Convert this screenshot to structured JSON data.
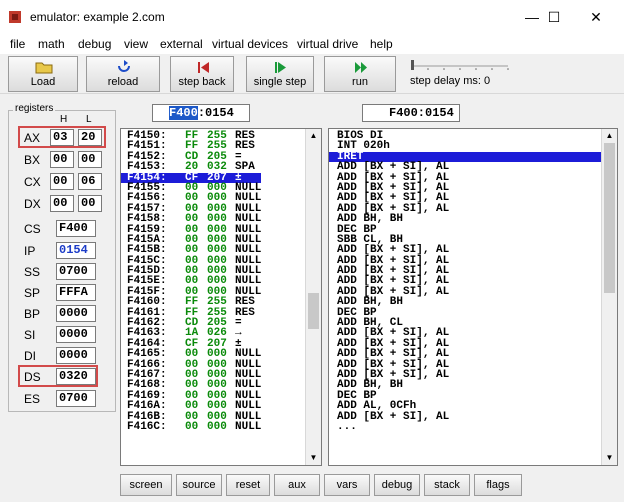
{
  "window": {
    "title": "emulator: example 2.com",
    "minimize": "—",
    "maximize": "☐",
    "close": "✕"
  },
  "menu": [
    "file",
    "math",
    "debug",
    "view",
    "external",
    "virtual devices",
    "virtual drive",
    "help"
  ],
  "toolbar": {
    "load": "Load",
    "reload": "reload",
    "step_back": "step back",
    "single_step": "single step",
    "run": "run",
    "step_delay": "step delay ms: 0"
  },
  "address_left": {
    "selected": "F400",
    "rest": ":0154"
  },
  "address_right": "F400:0154",
  "registers": {
    "legend": "registers",
    "h_label": "H",
    "l_label": "L",
    "AX": {
      "name": "AX",
      "h": "03",
      "l": "20"
    },
    "BX": {
      "name": "BX",
      "h": "00",
      "l": "00"
    },
    "CX": {
      "name": "CX",
      "h": "00",
      "l": "06"
    },
    "DX": {
      "name": "DX",
      "h": "00",
      "l": "00"
    },
    "CS": {
      "name": "CS",
      "value": "F400"
    },
    "IP": {
      "name": "IP",
      "value": "0154"
    },
    "SS": {
      "name": "SS",
      "value": "0700"
    },
    "SP": {
      "name": "SP",
      "value": "FFFA"
    },
    "BP": {
      "name": "BP",
      "value": "0000"
    },
    "SI": {
      "name": "SI",
      "value": "0000"
    },
    "DI": {
      "name": "DI",
      "value": "0000"
    },
    "DS": {
      "name": "DS",
      "value": "0320"
    },
    "ES": {
      "name": "ES",
      "value": "0700"
    }
  },
  "memory": [
    {
      "addr": "F4150:",
      "hex": "FF",
      "dec": "255",
      "chr": "RES"
    },
    {
      "addr": "F4151:",
      "hex": "FF",
      "dec": "255",
      "chr": "RES"
    },
    {
      "addr": "F4152:",
      "hex": "CD",
      "dec": "205",
      "chr": "="
    },
    {
      "addr": "F4153:",
      "hex": "20",
      "dec": "032",
      "chr": "SPA"
    },
    {
      "addr": "F4154:",
      "hex": "CF",
      "dec": "207",
      "chr": "±",
      "selected": true
    },
    {
      "addr": "F4155:",
      "hex": "00",
      "dec": "000",
      "chr": "NULL"
    },
    {
      "addr": "F4156:",
      "hex": "00",
      "dec": "000",
      "chr": "NULL"
    },
    {
      "addr": "F4157:",
      "hex": "00",
      "dec": "000",
      "chr": "NULL"
    },
    {
      "addr": "F4158:",
      "hex": "00",
      "dec": "000",
      "chr": "NULL"
    },
    {
      "addr": "F4159:",
      "hex": "00",
      "dec": "000",
      "chr": "NULL"
    },
    {
      "addr": "F415A:",
      "hex": "00",
      "dec": "000",
      "chr": "NULL"
    },
    {
      "addr": "F415B:",
      "hex": "00",
      "dec": "000",
      "chr": "NULL"
    },
    {
      "addr": "F415C:",
      "hex": "00",
      "dec": "000",
      "chr": "NULL"
    },
    {
      "addr": "F415D:",
      "hex": "00",
      "dec": "000",
      "chr": "NULL"
    },
    {
      "addr": "F415E:",
      "hex": "00",
      "dec": "000",
      "chr": "NULL"
    },
    {
      "addr": "F415F:",
      "hex": "00",
      "dec": "000",
      "chr": "NULL"
    },
    {
      "addr": "F4160:",
      "hex": "FF",
      "dec": "255",
      "chr": "RES"
    },
    {
      "addr": "F4161:",
      "hex": "FF",
      "dec": "255",
      "chr": "RES"
    },
    {
      "addr": "F4162:",
      "hex": "CD",
      "dec": "205",
      "chr": "="
    },
    {
      "addr": "F4163:",
      "hex": "1A",
      "dec": "026",
      "chr": "→"
    },
    {
      "addr": "F4164:",
      "hex": "CF",
      "dec": "207",
      "chr": "±"
    },
    {
      "addr": "F4165:",
      "hex": "00",
      "dec": "000",
      "chr": "NULL"
    },
    {
      "addr": "F4166:",
      "hex": "00",
      "dec": "000",
      "chr": "NULL"
    },
    {
      "addr": "F4167:",
      "hex": "00",
      "dec": "000",
      "chr": "NULL"
    },
    {
      "addr": "F4168:",
      "hex": "00",
      "dec": "000",
      "chr": "NULL"
    },
    {
      "addr": "F4169:",
      "hex": "00",
      "dec": "000",
      "chr": "NULL"
    },
    {
      "addr": "F416A:",
      "hex": "00",
      "dec": "000",
      "chr": "NULL"
    },
    {
      "addr": "F416B:",
      "hex": "00",
      "dec": "000",
      "chr": "NULL"
    },
    {
      "addr": "F416C:",
      "hex": "00",
      "dec": "000",
      "chr": "NULL"
    }
  ],
  "disassembly": [
    {
      "text": "BIOS DI"
    },
    {
      "text": "INT 020h"
    },
    {
      "text": "IRET",
      "selected": true
    },
    {
      "text": "ADD [BX + SI], AL"
    },
    {
      "text": "ADD [BX + SI], AL"
    },
    {
      "text": "ADD [BX + SI], AL"
    },
    {
      "text": "ADD [BX + SI], AL"
    },
    {
      "text": "ADD [BX + SI], AL"
    },
    {
      "text": "ADD BH, BH"
    },
    {
      "text": "DEC BP"
    },
    {
      "text": "SBB CL, BH"
    },
    {
      "text": "ADD [BX + SI], AL"
    },
    {
      "text": "ADD [BX + SI], AL"
    },
    {
      "text": "ADD [BX + SI], AL"
    },
    {
      "text": "ADD [BX + SI], AL"
    },
    {
      "text": "ADD [BX + SI], AL"
    },
    {
      "text": "ADD BH, BH"
    },
    {
      "text": "DEC BP"
    },
    {
      "text": "ADD BH, CL"
    },
    {
      "text": "ADD [BX + SI], AL"
    },
    {
      "text": "ADD [BX + SI], AL"
    },
    {
      "text": "ADD [BX + SI], AL"
    },
    {
      "text": "ADD [BX + SI], AL"
    },
    {
      "text": "ADD [BX + SI], AL"
    },
    {
      "text": "ADD BH, BH"
    },
    {
      "text": "DEC BP"
    },
    {
      "text": "ADD AL, 0CFh"
    },
    {
      "text": "ADD [BX + SI], AL"
    },
    {
      "text": "..."
    }
  ],
  "bottom_buttons": [
    "screen",
    "source",
    "reset",
    "aux",
    "vars",
    "debug",
    "stack",
    "flags"
  ],
  "colors": {
    "selection": "#1c1cd8",
    "hex_green": "#0a8a0a",
    "highlight_frame": "#d24a4a",
    "pointer_blue": "#1c3cc8"
  }
}
